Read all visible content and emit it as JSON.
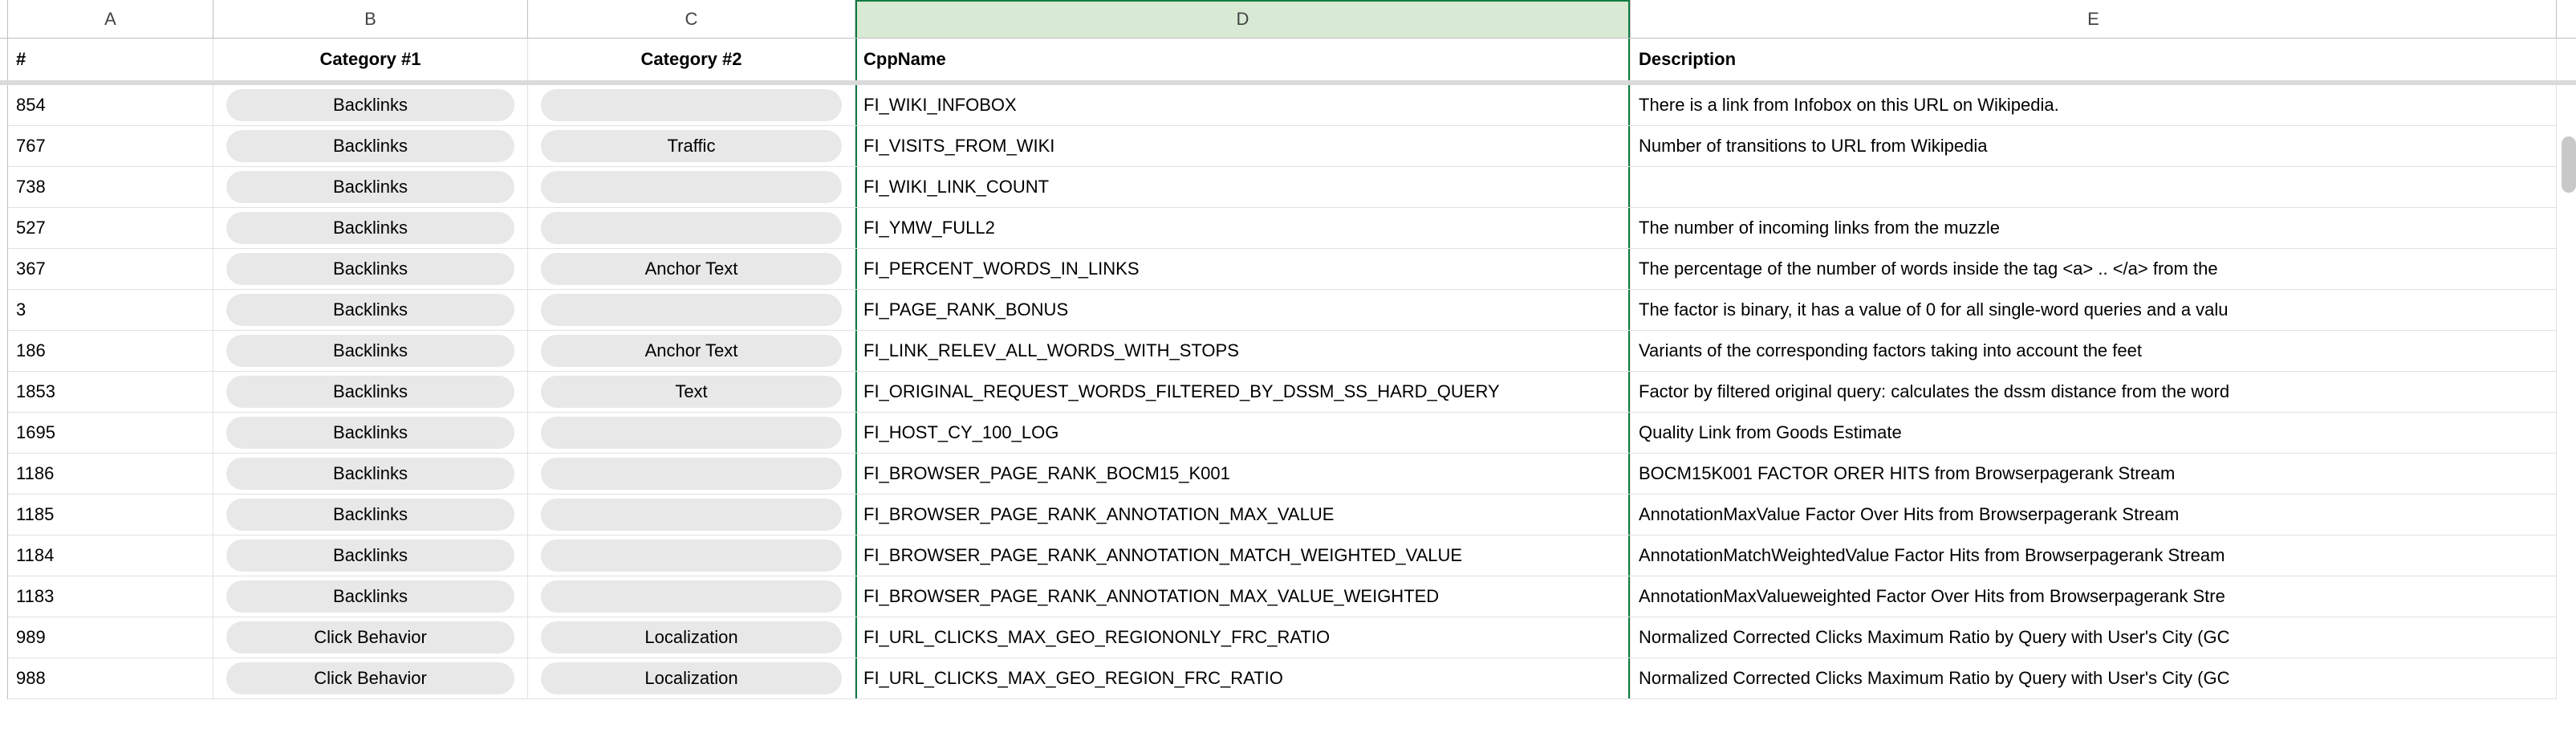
{
  "columns": {
    "A": "A",
    "B": "B",
    "C": "C",
    "D": "D",
    "E": "E"
  },
  "headers": {
    "A": "#",
    "B": "Category #1",
    "C": "Category #2",
    "D": "CppName",
    "E": "Description"
  },
  "rows": [
    {
      "A": "854",
      "B": "Backlinks",
      "C": "",
      "D": "FI_WIKI_INFOBOX",
      "E": "There is a link from Infobox on this URL on Wikipedia."
    },
    {
      "A": "767",
      "B": "Backlinks",
      "C": "Traffic",
      "D": "FI_VISITS_FROM_WIKI",
      "E": "Number of transitions to URL from Wikipedia"
    },
    {
      "A": "738",
      "B": "Backlinks",
      "C": "",
      "D": "FI_WIKI_LINK_COUNT",
      "E": ""
    },
    {
      "A": "527",
      "B": "Backlinks",
      "C": "",
      "D": "FI_YMW_FULL2",
      "E": "The number of incoming links from the muzzle"
    },
    {
      "A": "367",
      "B": "Backlinks",
      "C": "Anchor Text",
      "D": "FI_PERCENT_WORDS_IN_LINKS",
      "E": "The percentage of the number of words inside the tag <a> .. </a> from the "
    },
    {
      "A": "3",
      "B": "Backlinks",
      "C": "",
      "D": "FI_PAGE_RANK_BONUS",
      "E": "The factor is binary, it has a value of 0 for all single-word queries and a valu"
    },
    {
      "A": "186",
      "B": "Backlinks",
      "C": "Anchor Text",
      "D": "FI_LINK_RELEV_ALL_WORDS_WITH_STOPS",
      "E": "Variants of the corresponding factors taking into account the feet"
    },
    {
      "A": "1853",
      "B": "Backlinks",
      "C": "Text",
      "D": "FI_ORIGINAL_REQUEST_WORDS_FILTERED_BY_DSSM_SS_HARD_QUERY",
      "E": "Factor by filtered original query: calculates the dssm distance from the word"
    },
    {
      "A": "1695",
      "B": "Backlinks",
      "C": "",
      "D": "FI_HOST_CY_100_LOG",
      "E": "Quality Link from Goods Estimate"
    },
    {
      "A": "1186",
      "B": "Backlinks",
      "C": "",
      "D": "FI_BROWSER_PAGE_RANK_BOCM15_K001",
      "E": "BOCM15K001 FACTOR ORER HITS from Browserpagerank Stream"
    },
    {
      "A": "1185",
      "B": "Backlinks",
      "C": "",
      "D": "FI_BROWSER_PAGE_RANK_ANNOTATION_MAX_VALUE",
      "E": "AnnotationMaxValue Factor Over Hits from Browserpagerank Stream"
    },
    {
      "A": "1184",
      "B": "Backlinks",
      "C": "",
      "D": "FI_BROWSER_PAGE_RANK_ANNOTATION_MATCH_WEIGHTED_VALUE",
      "E": "AnnotationMatchWeightedValue Factor Hits from Browserpagerank Stream"
    },
    {
      "A": "1183",
      "B": "Backlinks",
      "C": "",
      "D": "FI_BROWSER_PAGE_RANK_ANNOTATION_MAX_VALUE_WEIGHTED",
      "E": "AnnotationMaxValueweighted Factor Over Hits from Browserpagerank Stre"
    },
    {
      "A": "989",
      "B": "Click Behavior",
      "C": "Localization",
      "D": "FI_URL_CLICKS_MAX_GEO_REGIONONLY_FRC_RATIO",
      "E": "Normalized Corrected Clicks Maximum Ratio by Query with User's City (GC"
    },
    {
      "A": "988",
      "B": "Click Behavior",
      "C": "Localization",
      "D": "FI_URL_CLICKS_MAX_GEO_REGION_FRC_RATIO",
      "E": "Normalized Corrected Clicks Maximum Ratio by Query with User's City (GC"
    }
  ]
}
